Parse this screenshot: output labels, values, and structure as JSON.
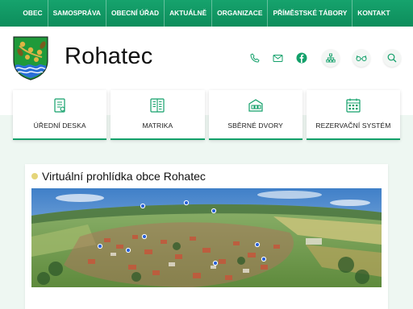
{
  "nav": {
    "items": [
      {
        "label": "OBEC"
      },
      {
        "label": "SAMOSPRÁVA"
      },
      {
        "label": "OBECNÍ ÚŘAD"
      },
      {
        "label": "AKTUÁLNĚ"
      },
      {
        "label": "ORGANIZACE"
      },
      {
        "label": "PŘÍMĚSTSKÉ TÁBORY"
      },
      {
        "label": "KONTAKT"
      }
    ]
  },
  "header": {
    "title": "Rohatec",
    "icons": [
      "phone-icon",
      "mail-icon",
      "facebook-icon",
      "sitemap-icon",
      "accessibility-glasses-icon",
      "search-icon"
    ]
  },
  "tiles": [
    {
      "label": "ÚŘEDNÍ DESKA",
      "icon": "notice-board-icon"
    },
    {
      "label": "MATRIKA",
      "icon": "registry-book-icon"
    },
    {
      "label": "SBĚRNÉ DVORY",
      "icon": "collection-yard-icon"
    },
    {
      "label": "REZERVAČNÍ SYSTÉM",
      "icon": "calendar-icon"
    }
  ],
  "article": {
    "title": "Virtuální prohlídka obce Rohatec",
    "image": "aerial-village-panorama"
  },
  "colors": {
    "accent": "#13a06a",
    "nav_bg": "#0d8d5b",
    "band_bg": "#eef7f2",
    "bullet": "#e5d57a"
  }
}
